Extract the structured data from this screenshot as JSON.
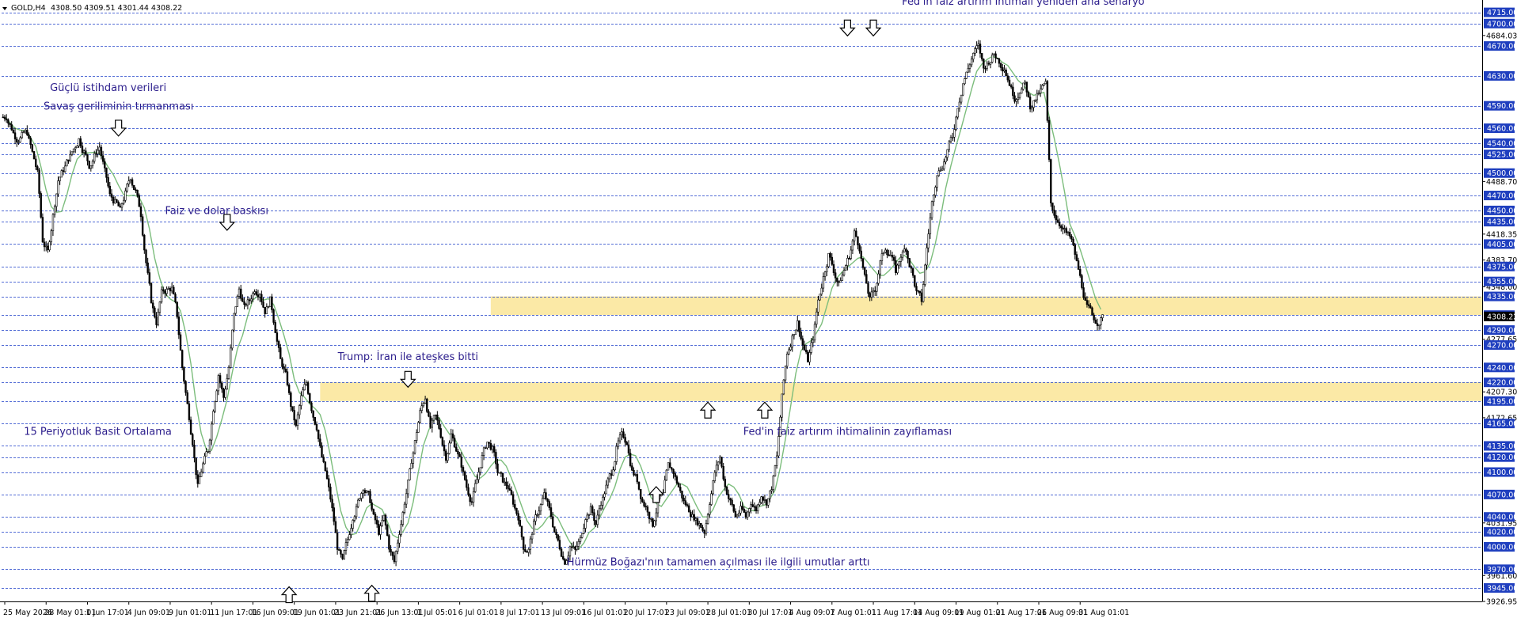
{
  "header": {
    "symbol_label": "GOLD,H4",
    "ohlc": "4308.50 4309.51 4301.44 4308.22"
  },
  "colors": {
    "background": "#ffffff",
    "candle": "#000000",
    "sma": "#7cbd7c",
    "grid_dashed": "#1a3cc8",
    "zone": "#fbe9a6",
    "annotation_text": "#2b1d8c",
    "price_tag_bg": "#1f3fbf",
    "price_tag_text": "#ffffff"
  },
  "chart_data": {
    "type": "candlestick",
    "title": "GOLD,H4",
    "indicator": "15 Periyotluk Basit Ortalama",
    "ylim": [
      3926.95,
      4722
    ],
    "price_levels": [
      4715,
      4700,
      4670,
      4630,
      4590,
      4560,
      4540,
      4525,
      4500,
      4470,
      4450,
      4435,
      4405,
      4375,
      4355,
      4335,
      4310,
      4290,
      4270,
      4240,
      4220,
      4195,
      4165,
      4135,
      4120,
      4100,
      4070,
      4040,
      4020,
      4000,
      3970,
      3945
    ],
    "tagged_levels": [
      4715,
      4700,
      4670,
      4630,
      4590,
      4560,
      4540,
      4525,
      4500,
      4470,
      4450,
      4435,
      4405,
      4375,
      4355,
      4335,
      4310,
      4290,
      4270,
      4240,
      4220,
      4195,
      4165,
      4135,
      4120,
      4100,
      4070,
      4040,
      4020,
      4000,
      3970,
      3945
    ],
    "extra_axis_labels": [
      "4684.03",
      "4488.70",
      "4418.35",
      "4383.70",
      "4348.00",
      "4277.65",
      "4207.30",
      "4172.65",
      "4031.95",
      "3961.60",
      "3926.95"
    ],
    "current_price": "4308.22",
    "zones": [
      {
        "from_index": 94,
        "to_index": 188,
        "low": 4310,
        "high": 4335
      },
      {
        "from_index": 61,
        "to_index": 188,
        "low": 4195,
        "high": 4220
      }
    ],
    "x_labels": [
      {
        "index": 0,
        "text": "25 May 2026"
      },
      {
        "index": 8,
        "text": "28 May 01:01"
      },
      {
        "index": 16,
        "text": "1 Jun 17:01"
      },
      {
        "index": 24,
        "text": "4 Jun 09:01"
      },
      {
        "index": 32,
        "text": "9 Jun 01:01"
      },
      {
        "index": 40,
        "text": "11 Jun 17:01"
      },
      {
        "index": 48,
        "text": "16 Jun 09:01"
      },
      {
        "index": 56,
        "text": "19 Jun 01:01"
      },
      {
        "index": 64,
        "text": "23 Jun 21:01"
      },
      {
        "index": 72,
        "text": "26 Jun 13:01"
      },
      {
        "index": 80,
        "text": "1 Jul 05:01"
      },
      {
        "index": 88,
        "text": "6 Jul 01:01"
      },
      {
        "index": 96,
        "text": "8 Jul 17:01"
      },
      {
        "index": 104,
        "text": "13 Jul 09:01"
      },
      {
        "index": 112,
        "text": "16 Jul 01:01"
      },
      {
        "index": 120,
        "text": "20 Jul 17:01"
      },
      {
        "index": 128,
        "text": "23 Jul 09:01"
      },
      {
        "index": 136,
        "text": "28 Jul 01:01"
      },
      {
        "index": 144,
        "text": "30 Jul 17:01"
      },
      {
        "index": 152,
        "text": "4 Aug 09:01"
      },
      {
        "index": 160,
        "text": "7 Aug 01:01"
      },
      {
        "index": 168,
        "text": "11 Aug 17:01"
      },
      {
        "index": 176,
        "text": "14 Aug 09:01"
      },
      {
        "index": 184,
        "text": "19 Aug 01:01"
      },
      {
        "index": 192,
        "text": "21 Aug 17:01"
      },
      {
        "index": 200,
        "text": "26 Aug 09:01"
      },
      {
        "index": 208,
        "text": "31 Aug 01:01"
      }
    ],
    "close_path": [
      [
        0,
        4575
      ],
      [
        2,
        4545
      ],
      [
        4,
        4555
      ],
      [
        6,
        4500
      ],
      [
        7,
        4410
      ],
      [
        8,
        4395
      ],
      [
        10,
        4490
      ],
      [
        12,
        4520
      ],
      [
        14,
        4545
      ],
      [
        16,
        4510
      ],
      [
        18,
        4535
      ],
      [
        20,
        4470
      ],
      [
        22,
        4450
      ],
      [
        24,
        4495
      ],
      [
        25,
        4475
      ],
      [
        26,
        4445
      ],
      [
        27,
        4380
      ],
      [
        28,
        4330
      ],
      [
        29,
        4300
      ],
      [
        30,
        4340
      ],
      [
        32,
        4345
      ],
      [
        33,
        4310
      ],
      [
        34,
        4240
      ],
      [
        35,
        4190
      ],
      [
        36,
        4140
      ],
      [
        37,
        4080
      ],
      [
        38,
        4110
      ],
      [
        39,
        4130
      ],
      [
        40,
        4185
      ],
      [
        41,
        4230
      ],
      [
        42,
        4200
      ],
      [
        43,
        4240
      ],
      [
        44,
        4310
      ],
      [
        45,
        4345
      ],
      [
        46,
        4320
      ],
      [
        47,
        4330
      ],
      [
        48,
        4345
      ],
      [
        49,
        4340
      ],
      [
        50,
        4315
      ],
      [
        51,
        4330
      ],
      [
        52,
        4290
      ],
      [
        53,
        4250
      ],
      [
        54,
        4230
      ],
      [
        55,
        4190
      ],
      [
        56,
        4160
      ],
      [
        57,
        4200
      ],
      [
        58,
        4220
      ],
      [
        59,
        4185
      ],
      [
        60,
        4160
      ],
      [
        61,
        4120
      ],
      [
        62,
        4090
      ],
      [
        63,
        4050
      ],
      [
        64,
        4000
      ],
      [
        65,
        3980
      ],
      [
        66,
        4010
      ],
      [
        67,
        4040
      ],
      [
        68,
        4060
      ],
      [
        69,
        4080
      ],
      [
        70,
        4070
      ],
      [
        71,
        4040
      ],
      [
        72,
        4020
      ],
      [
        73,
        4040
      ],
      [
        74,
        4000
      ],
      [
        75,
        3980
      ],
      [
        76,
        4020
      ],
      [
        77,
        4060
      ],
      [
        78,
        4100
      ],
      [
        79,
        4140
      ],
      [
        80,
        4180
      ],
      [
        81,
        4200
      ],
      [
        82,
        4160
      ],
      [
        83,
        4175
      ],
      [
        84,
        4150
      ],
      [
        85,
        4120
      ],
      [
        86,
        4150
      ],
      [
        87,
        4130
      ],
      [
        88,
        4110
      ],
      [
        89,
        4080
      ],
      [
        90,
        4060
      ],
      [
        91,
        4090
      ],
      [
        92,
        4120
      ],
      [
        93,
        4140
      ],
      [
        94,
        4130
      ],
      [
        95,
        4100
      ],
      [
        96,
        4090
      ],
      [
        97,
        4080
      ],
      [
        98,
        4060
      ],
      [
        99,
        4040
      ],
      [
        100,
        4000
      ],
      [
        101,
        3995
      ],
      [
        102,
        4030
      ],
      [
        103,
        4050
      ],
      [
        104,
        4070
      ],
      [
        105,
        4050
      ],
      [
        106,
        4020
      ],
      [
        107,
        4000
      ],
      [
        108,
        3980
      ],
      [
        109,
        4000
      ],
      [
        110,
        3995
      ],
      [
        111,
        4010
      ],
      [
        112,
        4040
      ],
      [
        113,
        4050
      ],
      [
        114,
        4030
      ],
      [
        115,
        4060
      ],
      [
        116,
        4080
      ],
      [
        117,
        4100
      ],
      [
        118,
        4130
      ],
      [
        119,
        4150
      ],
      [
        120,
        4140
      ],
      [
        121,
        4100
      ],
      [
        122,
        4090
      ],
      [
        123,
        4060
      ],
      [
        124,
        4050
      ],
      [
        125,
        4030
      ],
      [
        126,
        4060
      ],
      [
        127,
        4070
      ],
      [
        128,
        4110
      ],
      [
        129,
        4100
      ],
      [
        130,
        4080
      ],
      [
        131,
        4060
      ],
      [
        132,
        4050
      ],
      [
        133,
        4040
      ],
      [
        134,
        4030
      ],
      [
        135,
        4020
      ],
      [
        136,
        4060
      ],
      [
        137,
        4100
      ],
      [
        138,
        4120
      ],
      [
        139,
        4080
      ],
      [
        140,
        4060
      ],
      [
        141,
        4040
      ],
      [
        142,
        4050
      ],
      [
        143,
        4040
      ],
      [
        144,
        4060
      ],
      [
        145,
        4050
      ],
      [
        146,
        4070
      ],
      [
        147,
        4060
      ],
      [
        148,
        4080
      ],
      [
        149,
        4120
      ],
      [
        150,
        4200
      ],
      [
        151,
        4260
      ],
      [
        152,
        4280
      ],
      [
        153,
        4300
      ],
      [
        154,
        4270
      ],
      [
        155,
        4250
      ],
      [
        156,
        4280
      ],
      [
        157,
        4330
      ],
      [
        158,
        4360
      ],
      [
        159,
        4390
      ],
      [
        160,
        4370
      ],
      [
        161,
        4350
      ],
      [
        162,
        4370
      ],
      [
        163,
        4390
      ],
      [
        164,
        4420
      ],
      [
        165,
        4400
      ],
      [
        166,
        4360
      ],
      [
        167,
        4330
      ],
      [
        168,
        4345
      ],
      [
        169,
        4380
      ],
      [
        170,
        4400
      ],
      [
        171,
        4390
      ],
      [
        172,
        4370
      ],
      [
        173,
        4390
      ],
      [
        174,
        4400
      ],
      [
        175,
        4370
      ],
      [
        176,
        4340
      ],
      [
        177,
        4330
      ],
      [
        178,
        4400
      ],
      [
        179,
        4460
      ],
      [
        180,
        4500
      ],
      [
        181,
        4510
      ],
      [
        182,
        4530
      ],
      [
        183,
        4550
      ],
      [
        184,
        4590
      ],
      [
        185,
        4620
      ],
      [
        186,
        4640
      ],
      [
        187,
        4660
      ],
      [
        188,
        4670
      ],
      [
        189,
        4640
      ],
      [
        190,
        4650
      ],
      [
        191,
        4660
      ],
      [
        192,
        4650
      ],
      [
        193,
        4640
      ],
      [
        194,
        4620
      ],
      [
        195,
        4600
      ],
      [
        196,
        4610
      ],
      [
        197,
        4620
      ],
      [
        198,
        4590
      ],
      [
        199,
        4600
      ],
      [
        200,
        4610
      ],
      [
        201,
        4620
      ],
      [
        202,
        4460
      ],
      [
        203,
        4440
      ],
      [
        204,
        4430
      ],
      [
        205,
        4420
      ],
      [
        206,
        4410
      ],
      [
        207,
        4380
      ],
      [
        208,
        4350
      ],
      [
        209,
        4320
      ],
      [
        210,
        4310
      ],
      [
        211,
        4300
      ],
      [
        212,
        4308
      ]
    ],
    "annotations": [
      {
        "text": "Güçlü istihdam verileri",
        "index": 20,
        "price": 4610
      },
      {
        "text": "Savaş geriliminin tırmanması",
        "index": 22,
        "price": 4585
      },
      {
        "text": "Faiz ve dolar baskısı",
        "index": 41,
        "price": 4445
      },
      {
        "text": "Trump: İran ile ateşkes bitti",
        "index": 78,
        "price": 4250
      },
      {
        "text": "15 Periyotluk Basit Ortalama",
        "index": 18,
        "price": 4150
      },
      {
        "text": "Fed'in faiz artırım ihtimalinin zayıflaması",
        "index": 163,
        "price": 4150
      },
      {
        "text": "Hürmüz Boğazı'nın tamamen açılması ile ilgili umutlar arttı",
        "index": 138,
        "price": 3975
      },
      {
        "text": "Fed'in faiz artırım ihtimali yeniden ana senaryo",
        "index": 197,
        "price": 4725
      }
    ],
    "arrows": [
      {
        "dir": "down",
        "index": 22,
        "price": 4558
      },
      {
        "dir": "down",
        "index": 43,
        "price": 4432
      },
      {
        "dir": "down",
        "index": 78,
        "price": 4222
      },
      {
        "dir": "down",
        "index": 163,
        "price": 4692
      },
      {
        "dir": "down",
        "index": 168,
        "price": 4692
      },
      {
        "dir": "up",
        "index": 55,
        "price": 3938
      },
      {
        "dir": "up",
        "index": 71,
        "price": 3940
      },
      {
        "dir": "up",
        "index": 126,
        "price": 4072
      },
      {
        "dir": "up",
        "index": 136,
        "price": 4185
      },
      {
        "dir": "up",
        "index": 147,
        "price": 4185
      }
    ]
  }
}
